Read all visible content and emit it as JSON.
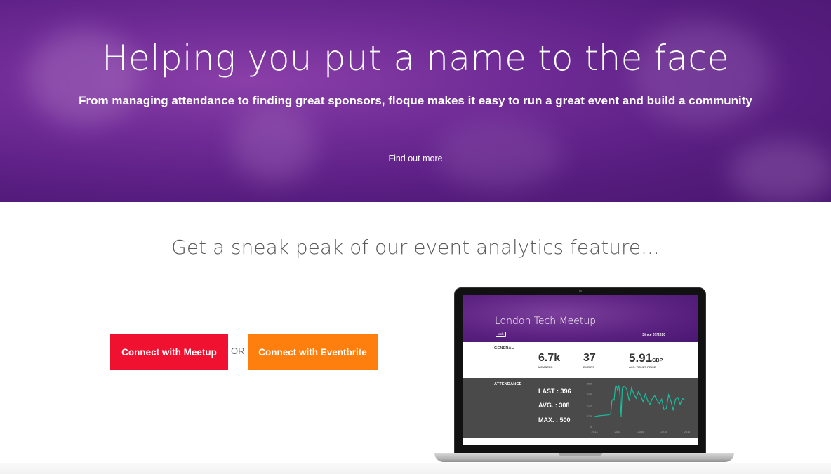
{
  "hero": {
    "title": "Helping you put a name to the face",
    "subtitle": "From managing attendance to finding great sponsors, floque makes it easy to run a great event and build a community",
    "link": "Find out more"
  },
  "analytics": {
    "title": "Get a sneak peak of our event analytics feature...",
    "meetup_button": "Connect with Meetup",
    "or_text": "OR",
    "eventbrite_button": "Connect with Eventbrite"
  },
  "colors": {
    "meetup": "#f0102f",
    "eventbrite": "#ff7f0e",
    "hero_purple": "#5b2180"
  },
  "preview": {
    "title": "London Tech Meetup",
    "tag": "tech",
    "since": "Since 07/2010",
    "general_label": "GENERAL",
    "stats": [
      {
        "value": "6.7k",
        "unit": "",
        "label": "MEMBERS"
      },
      {
        "value": "37",
        "unit": "",
        "label": "EVENTS"
      },
      {
        "value": "5.91",
        "unit": "GBP",
        "label": "AVG. TICKET PRICE"
      }
    ],
    "attendance_label": "ATTENDANCE",
    "last": "LAST : 396",
    "avg": "AVG. : 308",
    "max": "MAX. : 500"
  },
  "chart_data": {
    "type": "line",
    "y_ticks": [
      "500",
      "375",
      "250",
      "125",
      "0"
    ],
    "x_ticks": [
      "2013",
      "2014",
      "2015",
      "2016",
      "2017"
    ],
    "ylim": [
      0,
      500
    ],
    "series": [
      {
        "color": "#1abc9c",
        "x": [
          2013,
          2013.1,
          2013.2,
          2013.4,
          2013.6,
          2013.7,
          2013.75,
          2013.8,
          2013.85,
          2013.9,
          2013.95,
          2014.0,
          2014.05,
          2014.1,
          2014.15,
          2014.2,
          2014.3,
          2014.4,
          2014.5,
          2014.6,
          2014.7,
          2014.8,
          2014.9,
          2015.0,
          2015.1,
          2015.2,
          2015.3,
          2015.4,
          2015.5,
          2015.6,
          2015.7,
          2015.8,
          2015.9,
          2016.0,
          2016.1,
          2016.2,
          2016.3,
          2016.4,
          2016.5,
          2016.6,
          2016.7,
          2016.8,
          2016.9
        ],
        "y": [
          120,
          125,
          130,
          135,
          140,
          150,
          300,
          320,
          310,
          460,
          470,
          420,
          480,
          380,
          120,
          450,
          470,
          430,
          300,
          450,
          380,
          330,
          410,
          360,
          290,
          380,
          300,
          260,
          330,
          360,
          310,
          270,
          320,
          200,
          210,
          370,
          300,
          190,
          320,
          340,
          260,
          330,
          310
        ]
      }
    ]
  }
}
